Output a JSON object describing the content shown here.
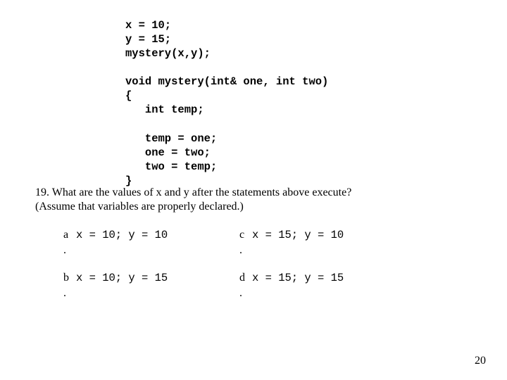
{
  "code": "x = 10;\ny = 15;\nmystery(x,y);\n\nvoid mystery(int& one, int two)\n{\n   int temp;\n\n   temp = one;\n   one = two;\n   two = temp;\n}",
  "question_line1": "19. What are the values of  x and y after the statements above execute?",
  "question_line2": "(Assume that variables are properly declared.)",
  "options": {
    "a": {
      "letter": "a",
      "dot": ".",
      "text": "x = 10; y = 10"
    },
    "b": {
      "letter": "b",
      "dot": ".",
      "text": "x = 10; y = 15"
    },
    "c": {
      "letter": "c",
      "dot": ".",
      "text": "x = 15; y = 10"
    },
    "d": {
      "letter": "d",
      "dot": ".",
      "text": "x = 15; y = 15"
    }
  },
  "page_number": "20"
}
